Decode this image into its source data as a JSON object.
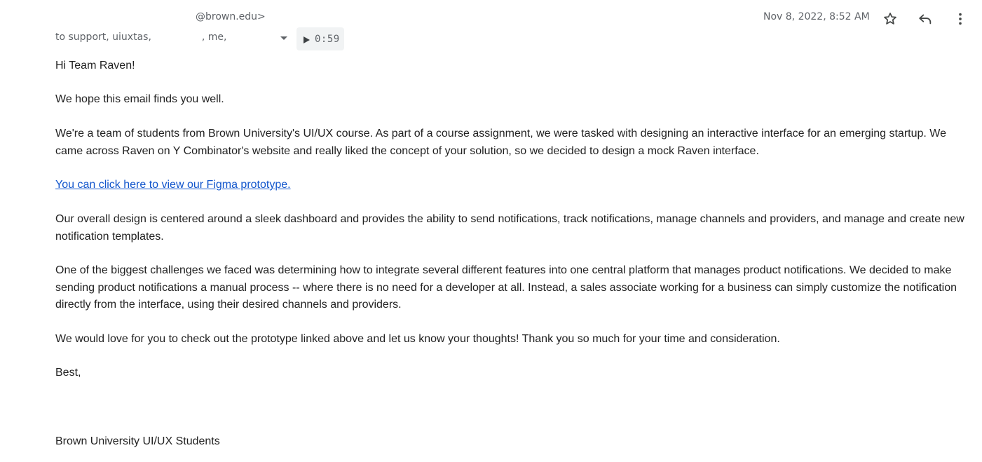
{
  "email": {
    "from_suffix": "@brown.edu>",
    "recipients": {
      "prefix": "to support, uiuxtas,",
      "middle": ", me,"
    },
    "audio_duration": "0:59",
    "date": "Nov 8, 2022, 8:52 AM",
    "icons": {
      "star": "star-icon",
      "reply": "reply-icon",
      "more": "more-vert-icon",
      "details": "dropdown-arrow-icon",
      "play": "play-icon"
    }
  },
  "body": {
    "greeting": "Hi Team Raven!",
    "hope": "We hope this email finds you well.",
    "intro": "We're a team of students from Brown University's UI/UX course. As part of a course assignment, we were tasked with designing an interactive interface for an emerging startup. We came across Raven on Y Combinator's website and really liked the concept of your solution, so we decided to design a mock Raven interface.",
    "link_text": "You can click here to view our Figma prototype.",
    "design": "Our overall design is centered around a sleek dashboard and provides the ability to send notifications, track notifications, manage channels and providers, and manage and create new notification templates.",
    "challenge": "One of the biggest challenges we faced was determining how to integrate several different features into one central platform that manages product notifications. We decided to make sending product notifications a manual process -- where there is no need for a developer at all. Instead, a sales associate working for a business can simply customize the notification directly from the interface, using their desired channels and providers.",
    "love": "We would love for you to check out the prototype linked above and let us know your thoughts! Thank you so much for your time and consideration.",
    "closing": "Best,",
    "signature": "Brown University UI/UX Students"
  }
}
